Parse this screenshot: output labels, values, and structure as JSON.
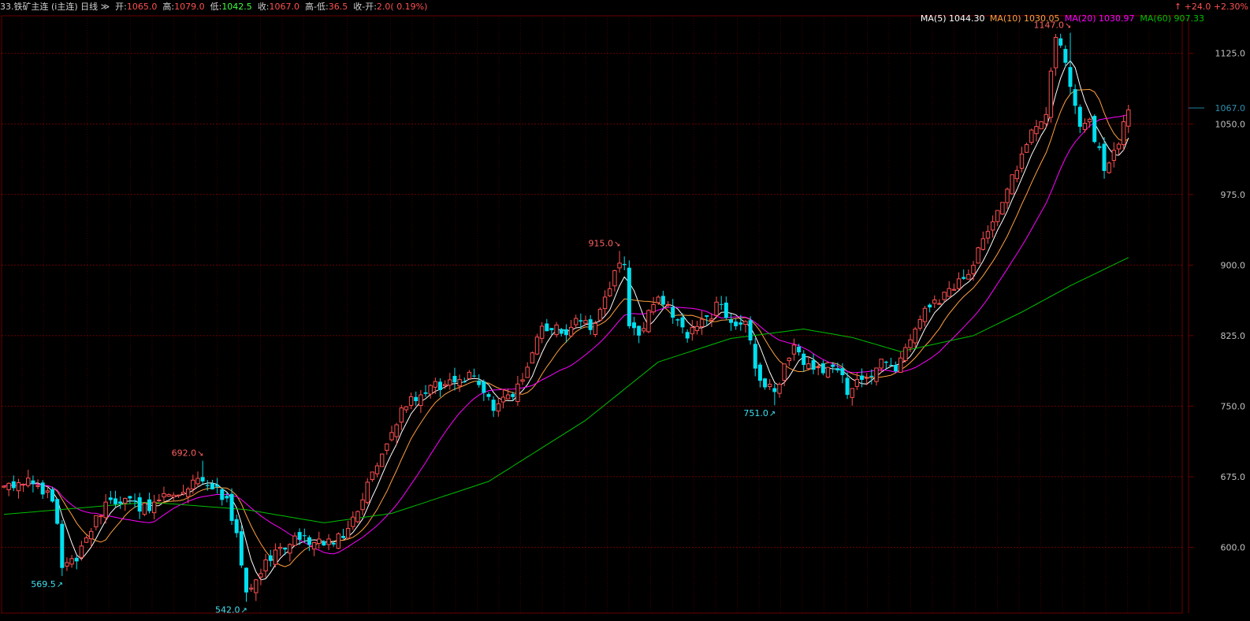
{
  "header": {
    "title": "33.铁矿主连 (i主连) 日线",
    "period_arrow": "≫",
    "open_label": "开:",
    "open": "1065.0",
    "high_label": "高:",
    "high": "1079.0",
    "low_label": "低:",
    "low": "1042.5",
    "close_label": "收:",
    "close": "1067.0",
    "range_label": "高-低:",
    "range": "36.5",
    "chg_label": "收-开:",
    "chg": "2.0( 0.19%)",
    "change_right": "↑ +24.0  +2.30%"
  },
  "colors": {
    "background": "#000000",
    "grid": "#6a0000",
    "up": "#ff5050",
    "down": "#00e0f0",
    "ma5": "#ffffff",
    "ma10": "#ffa040",
    "ma20": "#ff00ff",
    "ma60": "#00c000",
    "axis_text": "#c0c0c0",
    "annot_high": "#ff6060",
    "annot_low": "#40e0f0"
  },
  "chart_data": {
    "type": "candlestick",
    "y_ticks": [
      600,
      675,
      750,
      825,
      900,
      975,
      1050,
      1125
    ],
    "ylim": [
      530,
      1165
    ],
    "current_price": 1067.0,
    "ma_legend": [
      {
        "name": "MA(5)",
        "value": "1044.30",
        "color": "#ffffff"
      },
      {
        "name": "MA(10)",
        "value": "1030.05",
        "color": "#ffa040"
      },
      {
        "name": "MA(20)",
        "value": "1030.97",
        "color": "#ff00ff"
      },
      {
        "name": "MA(60)",
        "value": "907.33",
        "color": "#00c000"
      }
    ],
    "annotations": [
      {
        "text": "1147.0",
        "bar": 220,
        "value": 1147,
        "kind": "high"
      },
      {
        "text": "915.0",
        "bar": 127,
        "value": 915,
        "kind": "high"
      },
      {
        "text": "692.0",
        "bar": 41,
        "value": 692,
        "kind": "high"
      },
      {
        "text": "751.0",
        "bar": 159,
        "value": 751,
        "kind": "low"
      },
      {
        "text": "569.5",
        "bar": 12,
        "value": 569.5,
        "kind": "low"
      },
      {
        "text": "542.0",
        "bar": 50,
        "value": 542,
        "kind": "low"
      }
    ],
    "keypoints": [
      [
        0,
        665
      ],
      [
        4,
        667
      ],
      [
        9,
        660
      ],
      [
        11,
        625
      ],
      [
        12,
        578
      ],
      [
        15,
        585
      ],
      [
        17,
        610
      ],
      [
        21,
        648
      ],
      [
        25,
        652
      ],
      [
        28,
        638
      ],
      [
        31,
        648
      ],
      [
        34,
        656
      ],
      [
        38,
        662
      ],
      [
        41,
        670
      ],
      [
        46,
        652
      ],
      [
        48,
        615
      ],
      [
        50,
        552
      ],
      [
        53,
        572
      ],
      [
        57,
        600
      ],
      [
        61,
        608
      ],
      [
        66,
        602
      ],
      [
        71,
        620
      ],
      [
        73,
        638
      ],
      [
        76,
        680
      ],
      [
        80,
        722
      ],
      [
        84,
        760
      ],
      [
        88,
        772
      ],
      [
        92,
        778
      ],
      [
        97,
        782
      ],
      [
        101,
        745
      ],
      [
        104,
        762
      ],
      [
        107,
        778
      ],
      [
        111,
        835
      ],
      [
        115,
        827
      ],
      [
        119,
        840
      ],
      [
        122,
        838
      ],
      [
        127,
        902
      ],
      [
        128,
        900
      ],
      [
        129,
        835
      ],
      [
        131,
        825
      ],
      [
        134,
        858
      ],
      [
        137,
        858
      ],
      [
        141,
        822
      ],
      [
        145,
        845
      ],
      [
        148,
        858
      ],
      [
        151,
        835
      ],
      [
        153,
        840
      ],
      [
        155,
        790
      ],
      [
        157,
        770
      ],
      [
        159,
        765
      ],
      [
        163,
        815
      ],
      [
        166,
        795
      ],
      [
        169,
        785
      ],
      [
        172,
        788
      ],
      [
        174,
        762
      ],
      [
        177,
        778
      ],
      [
        181,
        800
      ],
      [
        184,
        787
      ],
      [
        188,
        832
      ],
      [
        191,
        855
      ],
      [
        195,
        875
      ],
      [
        199,
        890
      ],
      [
        202,
        928
      ],
      [
        205,
        958
      ],
      [
        208,
        996
      ],
      [
        211,
        1028
      ],
      [
        215,
        1060
      ],
      [
        217,
        1142
      ],
      [
        219,
        1115
      ],
      [
        222,
        1047
      ],
      [
        224,
        1055
      ],
      [
        227,
        1000
      ],
      [
        229,
        1022
      ],
      [
        232,
        1065
      ]
    ],
    "ma60_points": [
      [
        0,
        635
      ],
      [
        30,
        648
      ],
      [
        50,
        640
      ],
      [
        66,
        626
      ],
      [
        80,
        636
      ],
      [
        100,
        670
      ],
      [
        120,
        735
      ],
      [
        135,
        797
      ],
      [
        150,
        822
      ],
      [
        165,
        832
      ],
      [
        175,
        823
      ],
      [
        185,
        808
      ],
      [
        200,
        825
      ],
      [
        210,
        850
      ],
      [
        220,
        878
      ],
      [
        232,
        908
      ]
    ]
  }
}
